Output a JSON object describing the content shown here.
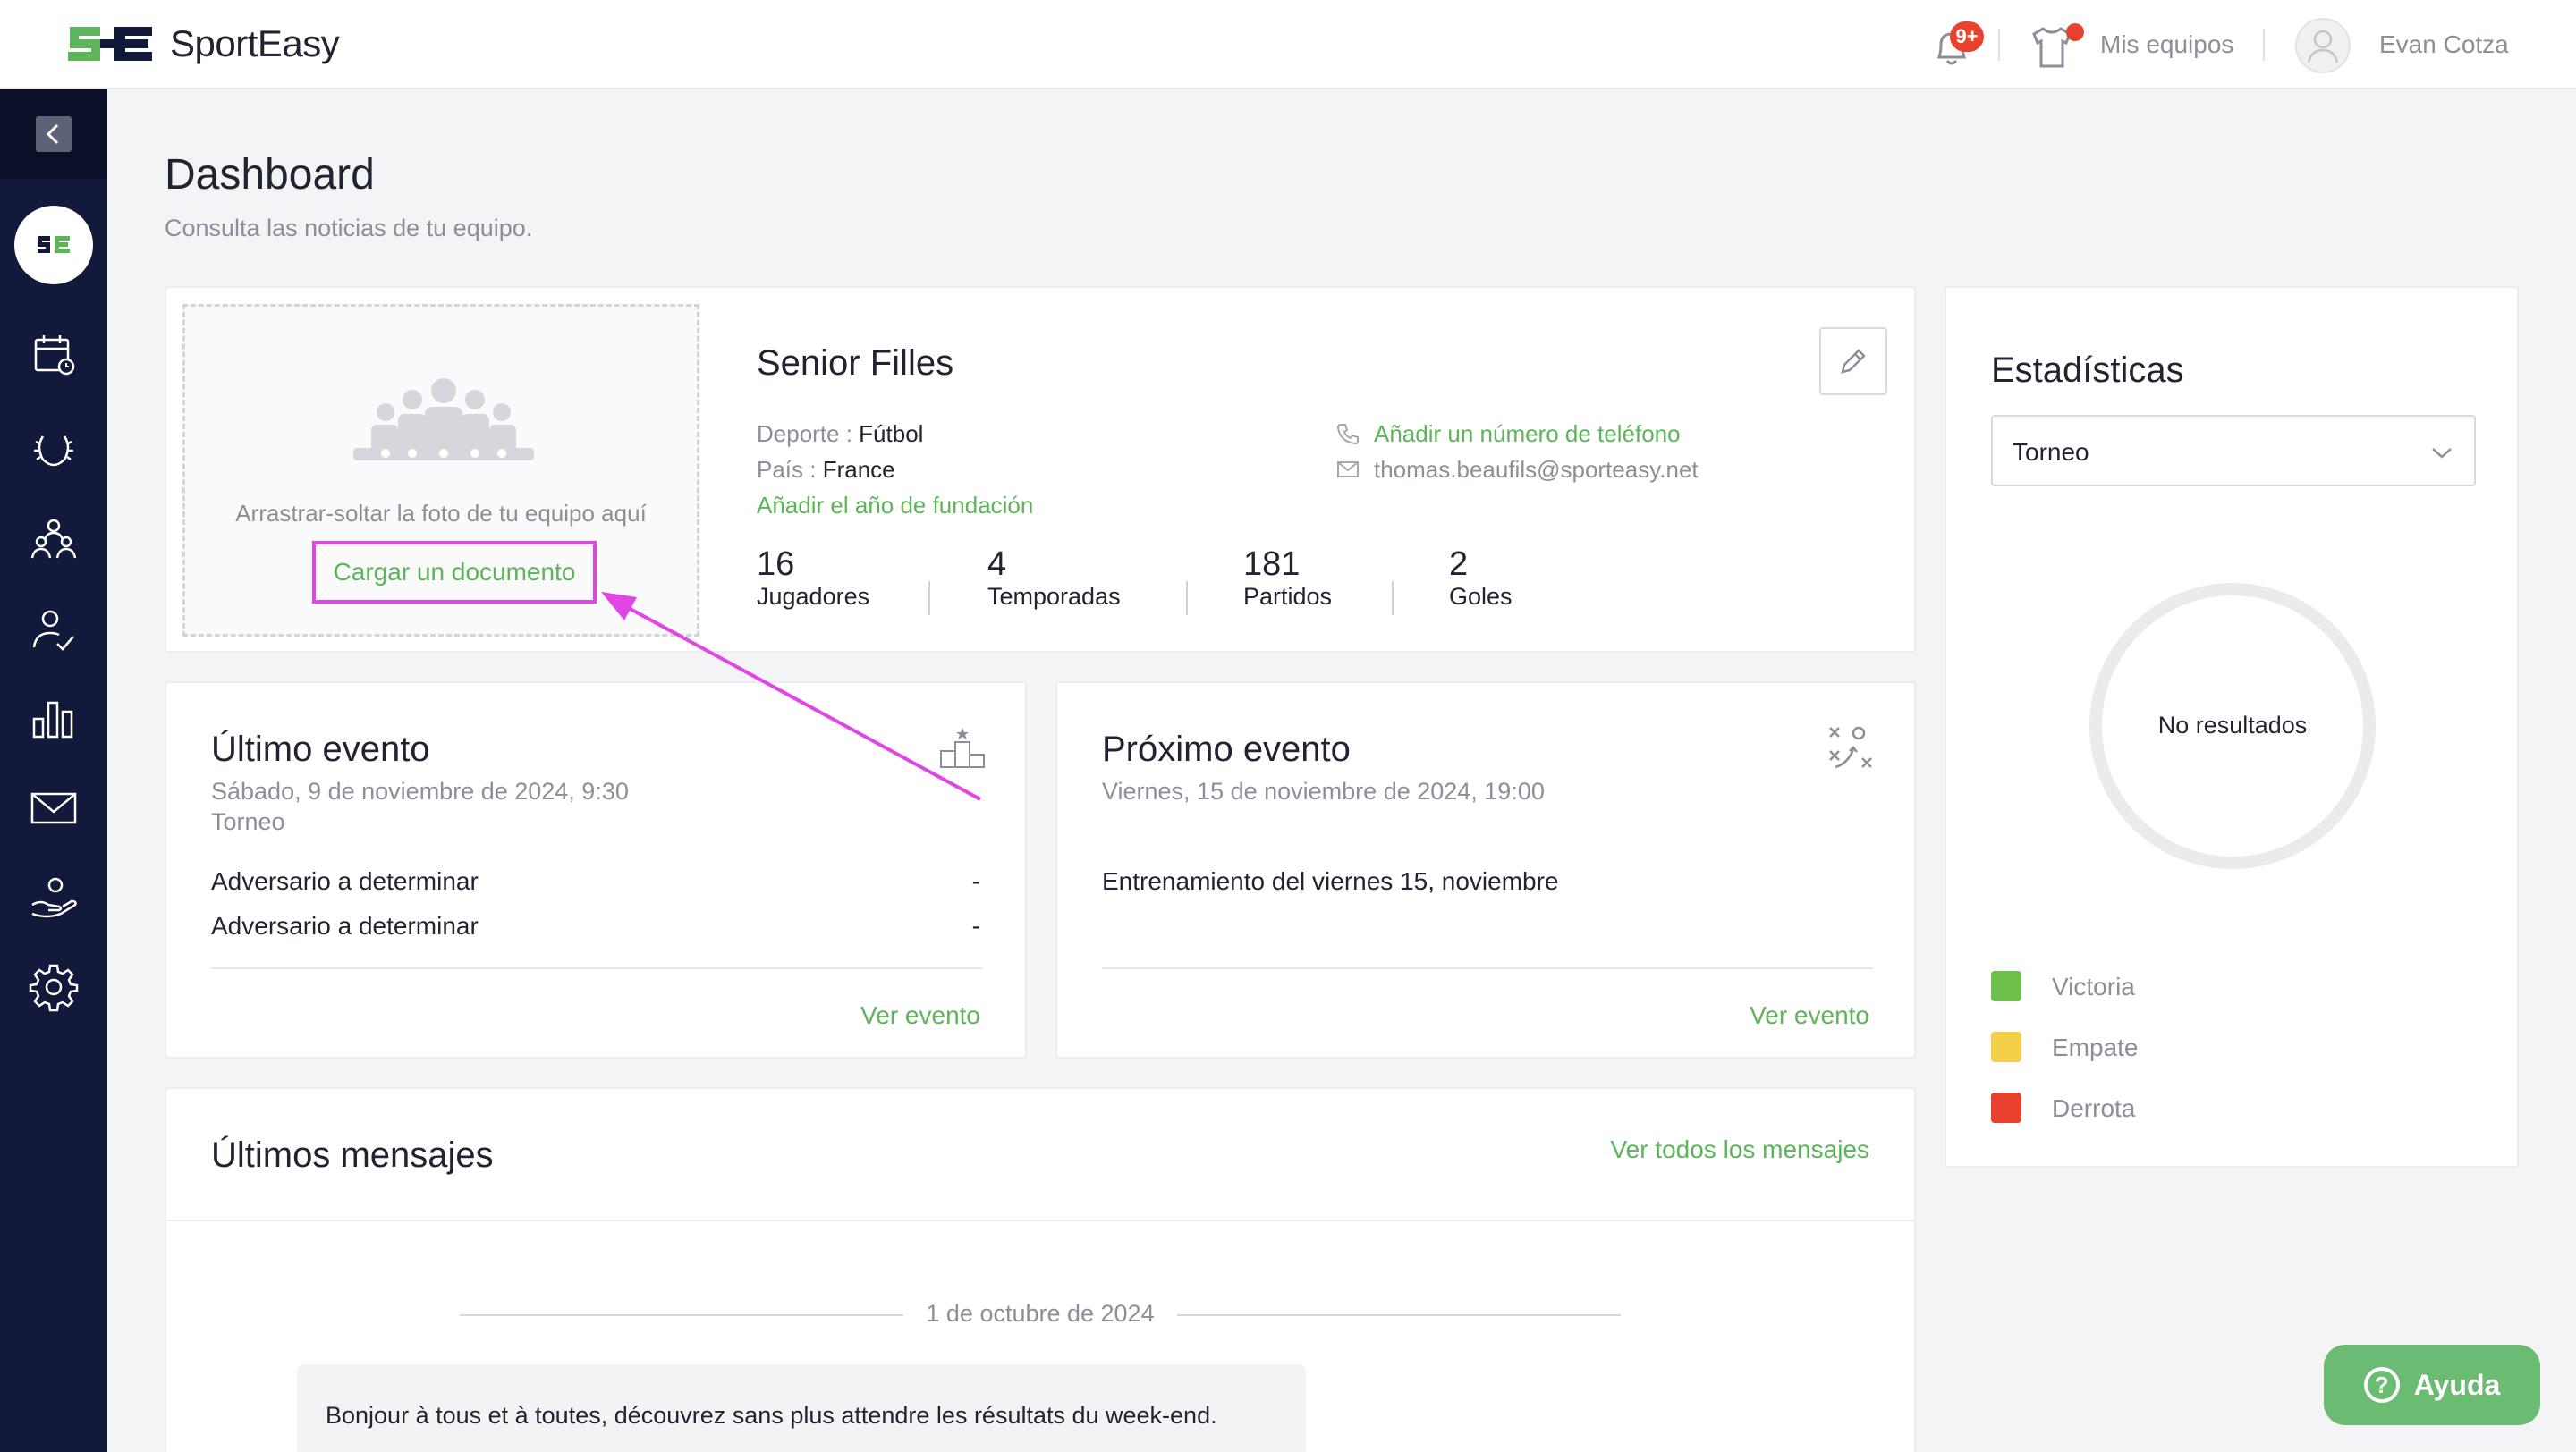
{
  "header": {
    "brand": "SportEasy",
    "notifications_badge": "9+",
    "my_teams_label": "Mis equipos",
    "user_name": "Evan Cotza"
  },
  "sidebar": {
    "items": [
      {
        "icon": "calendar-icon"
      },
      {
        "icon": "laurel-icon"
      },
      {
        "icon": "team-members-icon"
      },
      {
        "icon": "user-check-icon"
      },
      {
        "icon": "bar-chart-icon"
      },
      {
        "icon": "mail-icon"
      },
      {
        "icon": "hand-heart-icon"
      },
      {
        "icon": "gear-icon"
      }
    ]
  },
  "page": {
    "title": "Dashboard",
    "subtitle": "Consulta las noticias de tu equipo."
  },
  "team": {
    "dropzone_text": "Arrastrar-soltar la foto de tu equipo aquí",
    "upload_label": "Cargar un documento",
    "name": "Senior Filles",
    "sport_label": "Deporte : ",
    "sport_value": "Fútbol",
    "country_label": "País : ",
    "country_value": "France",
    "add_founding_year": "Añadir el año de fundación",
    "add_phone": "Añadir un número de teléfono",
    "email": "thomas.beaufils@sporteasy.net",
    "stats": [
      {
        "value": "16",
        "label": "Jugadores"
      },
      {
        "value": "4",
        "label": "Temporadas"
      },
      {
        "value": "181",
        "label": "Partidos"
      },
      {
        "value": "2",
        "label": "Goles"
      }
    ]
  },
  "last_event": {
    "title": "Último evento",
    "date": "Sábado, 9 de noviembre de 2024, 9:30",
    "type": "Torneo",
    "rows": [
      {
        "opponent": "Adversario a determinar",
        "score": "-"
      },
      {
        "opponent": "Adversario a determinar",
        "score": "-"
      }
    ],
    "link": "Ver evento"
  },
  "next_event": {
    "title": "Próximo evento",
    "date": "Viernes, 15 de noviembre de 2024, 19:00",
    "description": "Entrenamiento del viernes 15, noviembre",
    "link": "Ver evento"
  },
  "messages": {
    "title": "Últimos mensajes",
    "see_all": "Ver todos los mensajes",
    "date": "1 de octubre de 2024",
    "preview": "Bonjour à tous et à toutes,  découvrez sans plus attendre les résultats du week-end."
  },
  "stats": {
    "title": "Estadísticas",
    "selected": "Torneo",
    "empty": "No resultados",
    "legend": [
      {
        "label": "Victoria",
        "color": "#6cc04a"
      },
      {
        "label": "Empate",
        "color": "#f5cf47"
      },
      {
        "label": "Derrota",
        "color": "#e8412e"
      }
    ]
  },
  "help": {
    "label": "Ayuda"
  },
  "colors": {
    "accent_green": "#5db45a",
    "sidebar": "#12193a",
    "annotation": "#e046e6"
  }
}
